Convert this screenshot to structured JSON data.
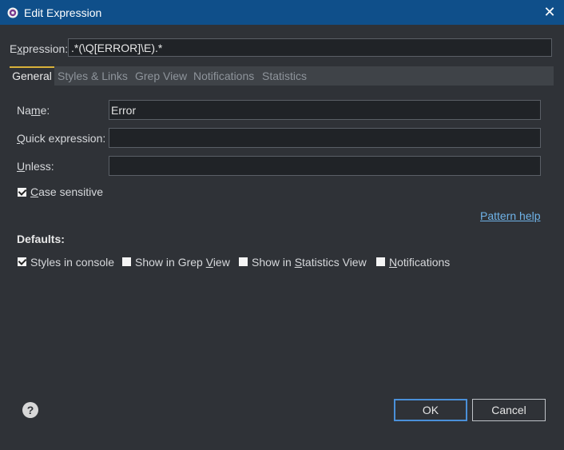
{
  "window": {
    "title": "Edit Expression",
    "close_glyph": "✕"
  },
  "expression": {
    "label_pre": "E",
    "label_mnemonic": "x",
    "label_post": "pression:",
    "value": ".*(\\Q[ERROR]\\E).*"
  },
  "tabs": [
    {
      "label": "General",
      "active": true
    },
    {
      "label": "Styles & Links"
    },
    {
      "label": "Grep View"
    },
    {
      "label": "Notifications"
    },
    {
      "label": "Statistics"
    }
  ],
  "general": {
    "name": {
      "label_pre": "Na",
      "label_mnemonic": "m",
      "label_post": "e:",
      "value": "Error"
    },
    "quick_expression": {
      "label_pre": "",
      "label_mnemonic": "Q",
      "label_post": "uick expression:",
      "value": ""
    },
    "unless": {
      "label_pre": "",
      "label_mnemonic": "U",
      "label_post": "nless:",
      "value": ""
    },
    "case_sensitive": {
      "label_pre": "",
      "label_mnemonic": "C",
      "label_post": "ase sensitive",
      "checked": true
    },
    "pattern_help": "Pattern help",
    "defaults_heading": "Defaults:",
    "defaults": {
      "styles_in_console": {
        "label": "Styles in console",
        "checked": true
      },
      "show_in_grep_view": {
        "label_pre": "Show in Grep ",
        "label_mnemonic": "V",
        "label_post": "iew",
        "checked": false
      },
      "show_in_statistics_view": {
        "label_pre": "Show in ",
        "label_mnemonic": "S",
        "label_post": "tatistics View",
        "checked": false
      },
      "notifications": {
        "label_pre": "",
        "label_mnemonic": "N",
        "label_post": "otifications",
        "checked": false
      }
    }
  },
  "buttons": {
    "help": "?",
    "ok": "OK",
    "cancel": "Cancel"
  },
  "colors": {
    "titlebar": "#0f4f8a",
    "background": "#2f3237",
    "link": "#6fb3e8",
    "active_tab_accent": "#d8b13a"
  }
}
